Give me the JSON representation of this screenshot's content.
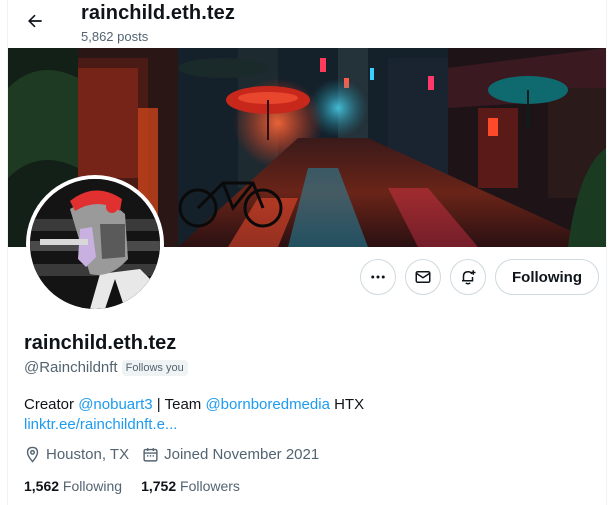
{
  "header": {
    "title": "rainchild.eth.tez",
    "posts_count": "5,862 posts"
  },
  "icons": {
    "back": "arrow-left-icon",
    "more": "more-horizontal-icon",
    "message": "envelope-icon",
    "notify": "bell-plus-icon",
    "location": "location-pin-icon",
    "calendar": "calendar-icon"
  },
  "profile": {
    "display_name": "rainchild.eth.tez",
    "handle": "@Rainchildnft",
    "follows_you": "Follows you",
    "bio": {
      "prefix": "Creator ",
      "mention1": "@nobuart3",
      "middle": " | Team ",
      "mention2": "@bornboredmedia",
      "suffix": " HTX"
    },
    "url": "linktr.ee/rainchildnft.e...",
    "location": "Houston, TX",
    "joined": "Joined November 2021",
    "following_count": "1,562",
    "following_label": " Following",
    "followers_count": "1,752",
    "followers_label": " Followers"
  },
  "actions": {
    "following_button": "Following"
  },
  "colors": {
    "accent": "#1d9bf0",
    "text_primary": "#0f1419",
    "text_secondary": "#536471",
    "border": "#cfd9de"
  }
}
